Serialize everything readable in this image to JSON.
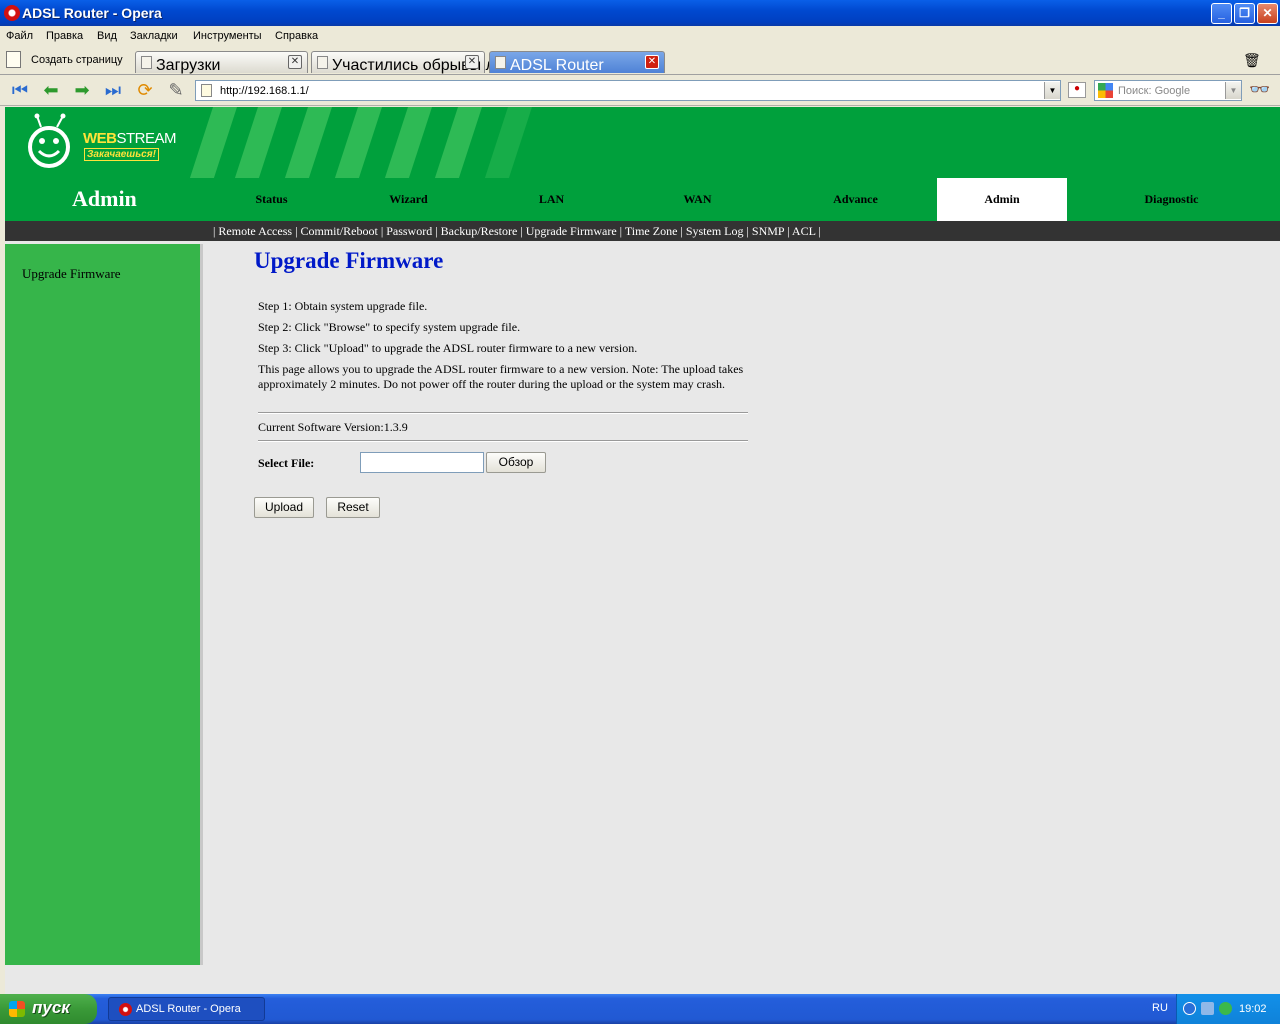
{
  "window": {
    "title": "ADSL Router - Opera"
  },
  "menubar": [
    "Файл",
    "Правка",
    "Вид",
    "Закладки",
    "Инструменты",
    "Справка"
  ],
  "tabbar": {
    "new_page_label": "Создать страницу",
    "tabs": [
      {
        "label": "Загрузки",
        "active": false
      },
      {
        "label": "Участились обрывы ли...",
        "active": false
      },
      {
        "label": "ADSL Router",
        "active": true
      }
    ]
  },
  "address": {
    "url": "http://192.168.1.1/",
    "search_placeholder": "Поиск: Google"
  },
  "router": {
    "logo": {
      "web": "WEB",
      "stream": "STREAM",
      "slogan": "Закачаешься!"
    },
    "section_title": "Admin",
    "top_nav": [
      {
        "label": "Status",
        "selected": false
      },
      {
        "label": "Wizard",
        "selected": false
      },
      {
        "label": "LAN",
        "selected": false
      },
      {
        "label": "WAN",
        "selected": false
      },
      {
        "label": "Advance",
        "selected": false
      },
      {
        "label": "Admin",
        "selected": true
      },
      {
        "label": "Diagnostic",
        "selected": false
      }
    ],
    "sub_nav": [
      "Remote Access",
      "Commit/Reboot",
      "Password",
      "Backup/Restore",
      "Upgrade Firmware",
      "Time Zone",
      "System Log",
      "SNMP",
      "ACL"
    ],
    "sidebar": {
      "item": "Upgrade Firmware"
    },
    "content": {
      "heading": "Upgrade Firmware",
      "step1": "Step 1: Obtain system upgrade file.",
      "step2": "Step 2: Click \"Browse\" to specify system upgrade file.",
      "step3": "Step 3: Click \"Upload\" to upgrade the ADSL router firmware to a new version.",
      "note": "This page allows you to upgrade the ADSL router firmware to a new version. Note: The upload takes approximately 2 minutes. Do not power off the router during the upload or the system may crash.",
      "version": "Current Software Version:1.3.9",
      "select_file_label": "Select File:",
      "browse_label": "Обзор",
      "upload_label": "Upload",
      "reset_label": "Reset"
    }
  },
  "taskbar": {
    "start_label": "пуск",
    "task_item": "ADSL Router - Opera",
    "language": "RU",
    "clock": "19:02"
  },
  "colors": {
    "router_green": "#00a03c",
    "sidebar_green": "#36b54a",
    "heading_blue": "#0019c8",
    "subnav_bg": "#333333"
  }
}
